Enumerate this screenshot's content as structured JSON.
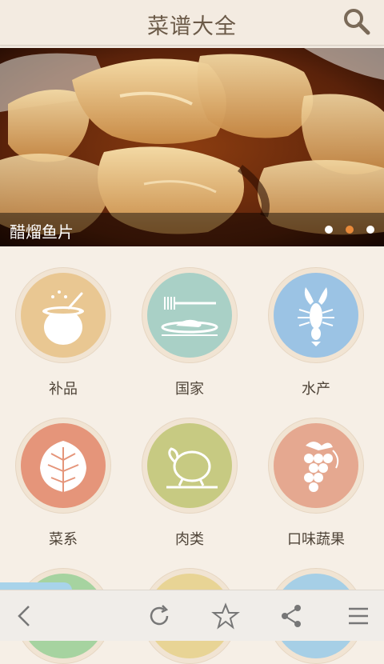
{
  "header": {
    "title": "菜谱大全",
    "search_icon": "search-icon"
  },
  "banner": {
    "caption": "醋熘鱼片",
    "slide_count": 3,
    "active_slide": 2
  },
  "categories": [
    {
      "label": "补品",
      "color": "#e9c792",
      "icon": "pot-icon"
    },
    {
      "label": "国家",
      "color": "#a9d0c6",
      "icon": "plate-icon"
    },
    {
      "label": "水产",
      "color": "#9bc3e4",
      "icon": "lobster-icon"
    },
    {
      "label": "菜系",
      "color": "#e5957a",
      "icon": "leaf-icon"
    },
    {
      "label": "肉类",
      "color": "#c7ca82",
      "icon": "chicken-icon"
    },
    {
      "label": "口味蔬果",
      "color": "#e5a890",
      "icon": "grapes-icon"
    }
  ],
  "partial_row_colors": [
    "#a6d3a0",
    "#e8d495",
    "#a6cfe6"
  ],
  "toolbar": {
    "back": "back-icon",
    "refresh": "refresh-icon",
    "favorite": "star-icon",
    "share": "share-icon",
    "menu": "menu-icon"
  }
}
